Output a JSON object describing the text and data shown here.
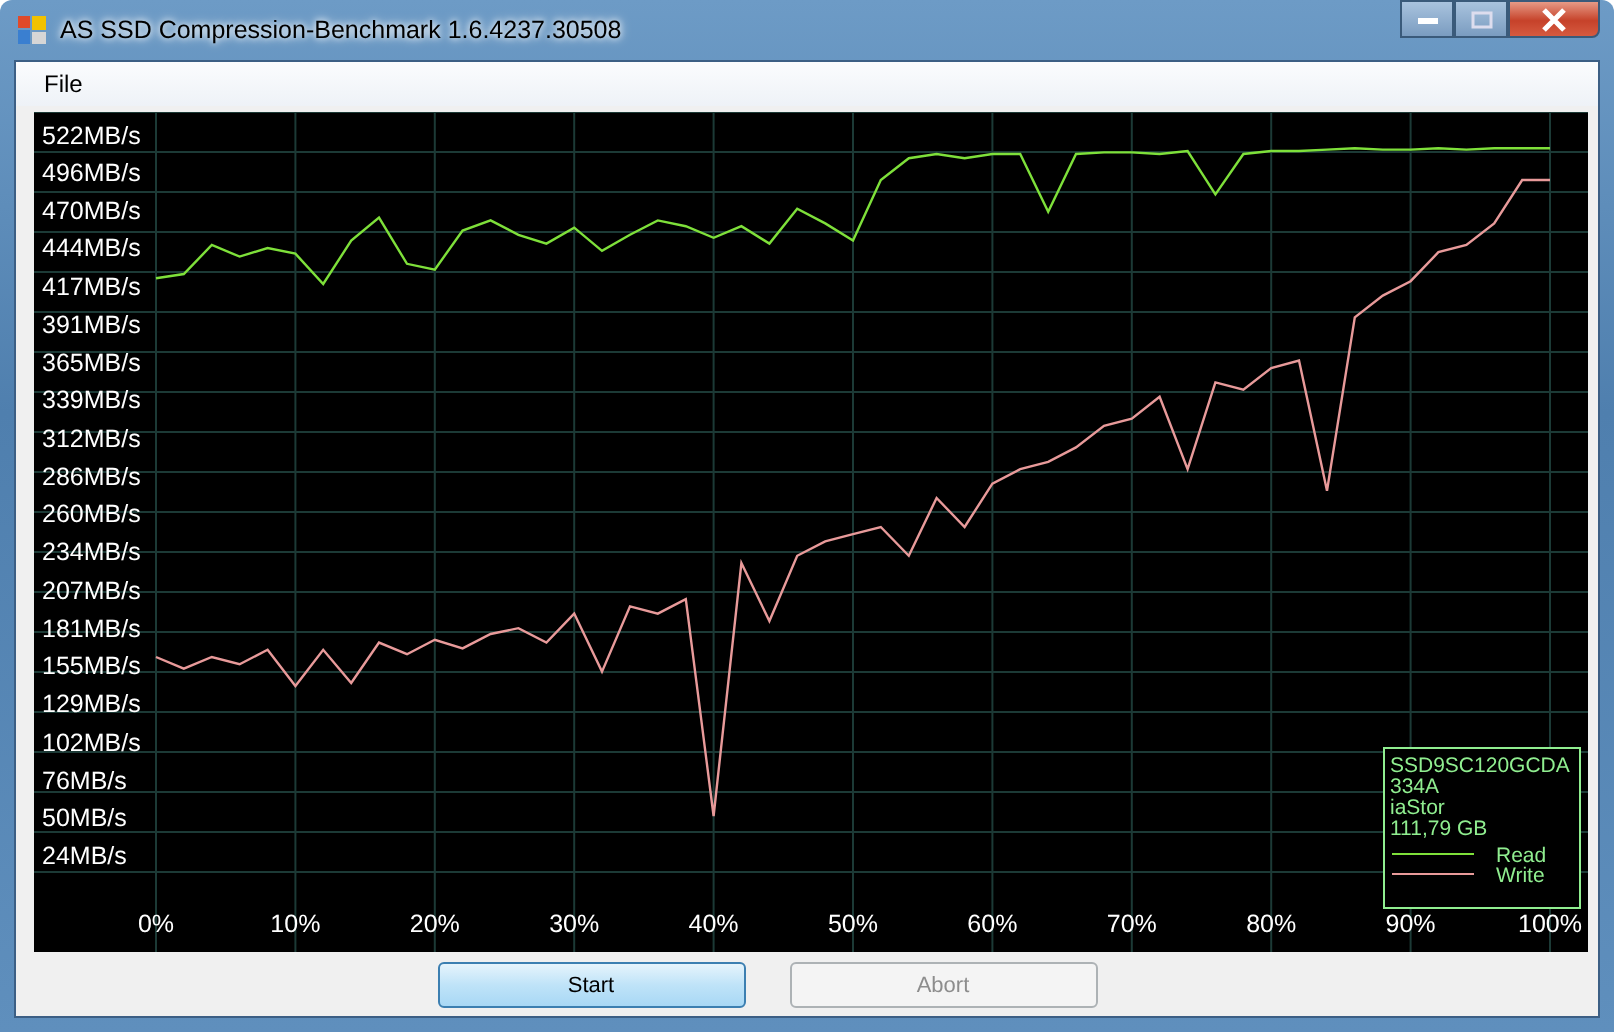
{
  "window": {
    "title": "AS SSD Compression-Benchmark 1.6.4237.30508"
  },
  "menu": [
    "File"
  ],
  "chart": {
    "device_info": [
      "SSD9SC120GCDA",
      "334A",
      "iaStor",
      "111,79 GB"
    ],
    "chart_data": {
      "type": "line",
      "x": [
        0,
        2,
        4,
        6,
        8,
        10,
        12,
        14,
        16,
        18,
        20,
        22,
        24,
        26,
        28,
        30,
        32,
        34,
        36,
        38,
        40,
        42,
        44,
        46,
        48,
        50,
        52,
        54,
        56,
        58,
        60,
        62,
        64,
        66,
        68,
        70,
        72,
        74,
        76,
        78,
        80,
        82,
        84,
        86,
        88,
        90,
        92,
        94,
        96,
        98,
        100
      ],
      "series": [
        {
          "name": "Read",
          "color": "#7ee03a",
          "values": [
            422,
            425,
            445,
            437,
            443,
            439,
            418,
            448,
            464,
            432,
            428,
            455,
            462,
            452,
            446,
            457,
            441,
            452,
            462,
            458,
            450,
            458,
            446,
            470,
            460,
            448,
            490,
            505,
            508,
            505,
            508,
            508,
            468,
            508,
            509,
            509,
            508,
            510,
            480,
            508,
            510,
            510,
            511,
            512,
            511,
            511,
            512,
            511,
            512,
            512,
            512
          ]
        },
        {
          "name": "Write",
          "color": "#e89a9a",
          "values": [
            160,
            152,
            160,
            155,
            165,
            140,
            165,
            142,
            170,
            162,
            172,
            166,
            176,
            180,
            170,
            190,
            150,
            195,
            190,
            200,
            50,
            225,
            185,
            230,
            240,
            245,
            250,
            230,
            270,
            250,
            280,
            290,
            295,
            305,
            320,
            325,
            340,
            290,
            350,
            345,
            360,
            365,
            275,
            395,
            410,
            420,
            440,
            445,
            460,
            490,
            490
          ]
        }
      ],
      "xlim": [
        0,
        100
      ],
      "ylim": [
        -44,
        537
      ],
      "grid": true,
      "legend": true,
      "xticks": [
        {
          "value": 0,
          "label": "0%"
        },
        {
          "value": 10,
          "label": "10%"
        },
        {
          "value": 20,
          "label": "20%"
        },
        {
          "value": 30,
          "label": "30%"
        },
        {
          "value": 40,
          "label": "40%"
        },
        {
          "value": 50,
          "label": "50%"
        },
        {
          "value": 60,
          "label": "60%"
        },
        {
          "value": 70,
          "label": "70%"
        },
        {
          "value": 80,
          "label": "80%"
        },
        {
          "value": 90,
          "label": "90%"
        },
        {
          "value": 100,
          "label": "100%"
        }
      ],
      "yticks": [
        {
          "value": 522,
          "label": "522MB/s"
        },
        {
          "value": 496,
          "label": "496MB/s"
        },
        {
          "value": 470,
          "label": "470MB/s"
        },
        {
          "value": 444,
          "label": "444MB/s"
        },
        {
          "value": 417,
          "label": "417MB/s"
        },
        {
          "value": 391,
          "label": "391MB/s"
        },
        {
          "value": 365,
          "label": "365MB/s"
        },
        {
          "value": 339,
          "label": "339MB/s"
        },
        {
          "value": 312,
          "label": "312MB/s"
        },
        {
          "value": 286,
          "label": "286MB/s"
        },
        {
          "value": 260,
          "label": "260MB/s"
        },
        {
          "value": 234,
          "label": "234MB/s"
        },
        {
          "value": 207,
          "label": "207MB/s"
        },
        {
          "value": 181,
          "label": "181MB/s"
        },
        {
          "value": 155,
          "label": "155MB/s"
        },
        {
          "value": 129,
          "label": "129MB/s"
        },
        {
          "value": 102,
          "label": "102MB/s"
        },
        {
          "value": 76,
          "label": "76MB/s"
        },
        {
          "value": 50,
          "label": "50MB/s"
        },
        {
          "value": 24,
          "label": "24MB/s"
        }
      ]
    }
  },
  "buttons": [
    {
      "label": "Start",
      "disabled": false
    },
    {
      "label": "Abort",
      "disabled": true
    }
  ]
}
